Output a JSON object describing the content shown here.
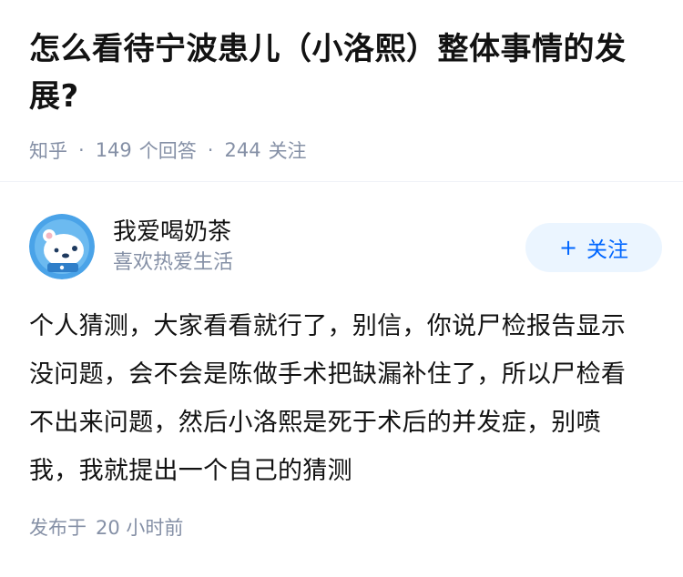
{
  "question": {
    "title": "怎么看待宁波患儿（小洛熙）整体事情的发展?",
    "source": "知乎",
    "answer_count": "149",
    "answer_label": "个回答",
    "follow_count": "244",
    "follow_label": "关注"
  },
  "answer": {
    "author_name": "我爱喝奶茶",
    "author_bio": "喜欢热爱生活",
    "follow_button_label": "关注",
    "follow_button_icon": "+",
    "content": "个人猜测，大家看看就行了，别信，你说尸检报告显示没问题，会不会是陈做手术把缺漏补住了，所以尸检看不出来问题，然后小洛熙是死于术后的并发症，别喷我，我就提出一个自己的猜测",
    "publish_label": "发布于",
    "publish_time": "20 小时前"
  },
  "colors": {
    "primary": "#0066ff",
    "follow_bg": "#ebf5ff",
    "meta_text": "#8590a6",
    "avatar_bg": "#4aa3e8"
  },
  "icons": {
    "avatar": "cartoon-bear-avatar"
  }
}
